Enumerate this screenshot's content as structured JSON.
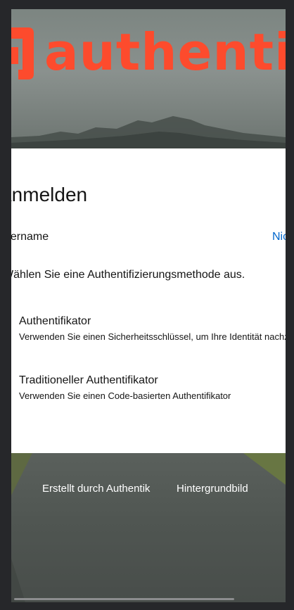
{
  "brand": {
    "logo_text": "authentik",
    "accent_color": "#fd4b2d"
  },
  "card": {
    "title": "Anmelden",
    "username": "username",
    "not_you_label": "Nicht Sie?",
    "prompt": "Wählen Sie eine Authentifizierungsmethode aus.",
    "options": [
      {
        "title": "Authentifikator",
        "description": "Verwenden Sie einen Sicherheitsschlüssel, um Ihre Identität nachzuweisen"
      },
      {
        "title": "Traditioneller Authentifikator",
        "description": "Verwenden Sie einen Code-basierten Authentifikator"
      }
    ]
  },
  "footer": {
    "powered_by": "Erstellt durch Authentik",
    "background_image": "Hintergrundbild"
  },
  "colors": {
    "link": "#0066cc",
    "text": "#151515",
    "page_frame": "#26272a"
  }
}
